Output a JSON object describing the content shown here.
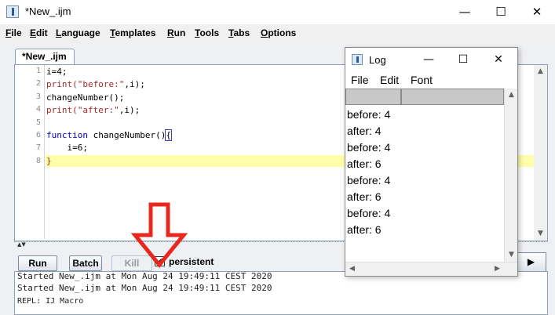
{
  "main_window": {
    "title": "*New_.ijm",
    "icon": "imagej-icon",
    "controls": {
      "minimize": "—",
      "maximize": "☐",
      "close": "✕"
    }
  },
  "menubar": [
    {
      "label": "File",
      "mnemonic": "F",
      "rest": "ile"
    },
    {
      "label": "Edit",
      "mnemonic": "E",
      "rest": "dit"
    },
    {
      "label": "Language",
      "mnemonic": "L",
      "rest": "anguage"
    },
    {
      "label": "Templates",
      "mnemonic": "T",
      "rest": "emplates"
    },
    {
      "label": "Run",
      "mnemonic": "R",
      "rest": "un"
    },
    {
      "label": "Tools",
      "mnemonic": "T",
      "rest": "ools"
    },
    {
      "label": "Tabs",
      "mnemonic": "T",
      "rest": "abs"
    },
    {
      "label": "Options",
      "mnemonic": "O",
      "rest": "ptions"
    }
  ],
  "tab": {
    "label": "*New_.ijm"
  },
  "editor": {
    "line_numbers": [
      "1",
      "2",
      "3",
      "4",
      "5",
      "6",
      "7",
      "8"
    ],
    "code": {
      "l1": "i=4;",
      "l2_fn": "print(",
      "l2_str": "\"before:\"",
      "l2_rest": ",i);",
      "l3": "changeNumber();",
      "l4_fn": "print(",
      "l4_str": "\"after:\"",
      "l4_rest": ",i);",
      "l6_kw": "function",
      "l6_name": " changeNumber()",
      "l6_brace": "{",
      "l7": "    i=6;",
      "l8": "}"
    },
    "current_line": 8
  },
  "toolbar": {
    "run_label": "Run",
    "batch_label": "Batch",
    "kill_label": "Kill",
    "persistent_label": "persistent",
    "persistent_checked": "✔",
    "run_arrow": "▶"
  },
  "console": {
    "lines": [
      "Started New_.ijm at Mon Aug 24 19:49:11 CEST 2020",
      "Started New_.ijm at Mon Aug 24 19:49:11 CEST 2020",
      "REPL: IJ Macro"
    ]
  },
  "log_window": {
    "title": "Log",
    "icon": "imagej-icon",
    "controls": {
      "minimize": "—",
      "maximize": "☐",
      "close": "✕"
    },
    "menu": [
      "File",
      "Edit",
      "Font"
    ],
    "lines": [
      "before: 4",
      "after: 4",
      "before: 4",
      "after: 6",
      "before: 4",
      "after: 6",
      "before: 4",
      "after: 6"
    ]
  },
  "annotation": {
    "color": "#e8281e",
    "icon": "down-arrow-annotation-icon"
  },
  "colors": {
    "keyword": "#0000c8",
    "string": "#a52a2a",
    "current_line": "#ffffaa"
  }
}
